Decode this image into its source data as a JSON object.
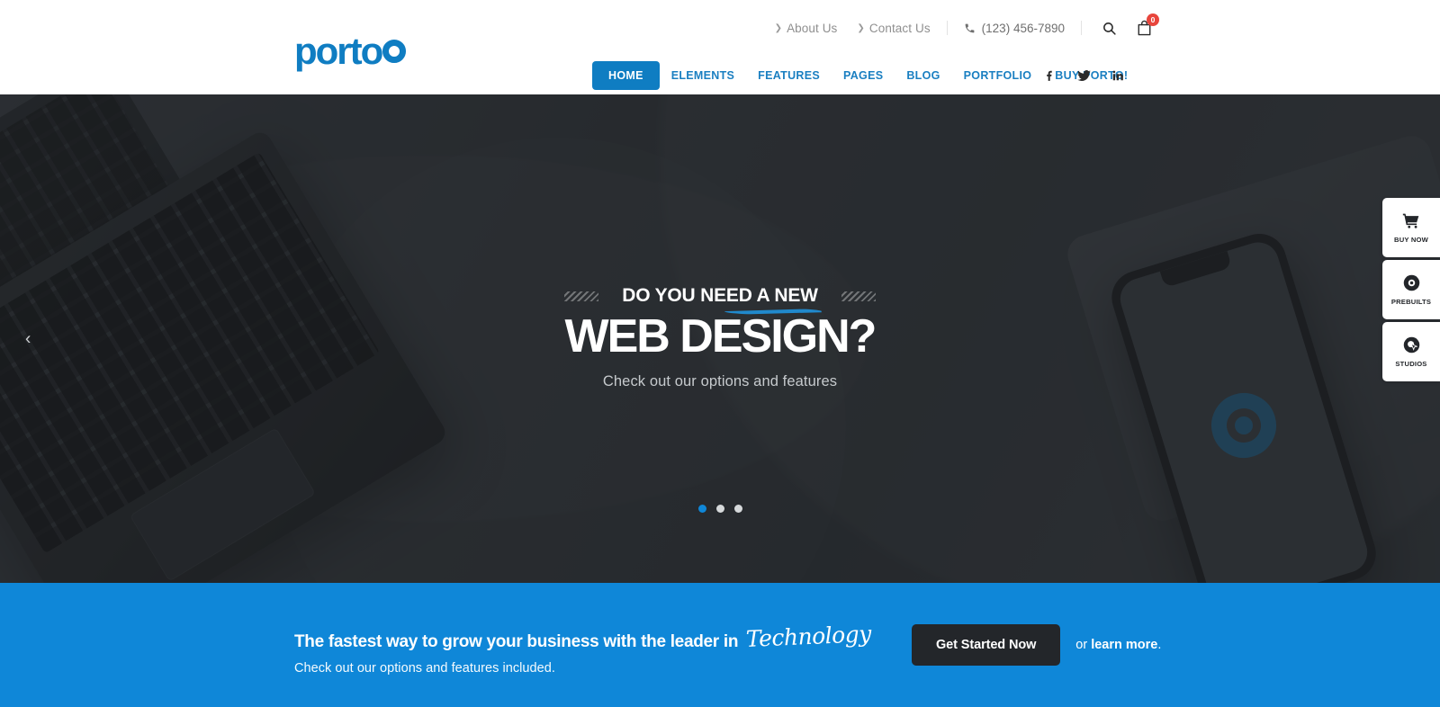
{
  "topbar": {
    "links": [
      {
        "label": "About Us",
        "icon": "chevron-right-icon"
      },
      {
        "label": "Contact Us",
        "icon": "chevron-right-icon"
      }
    ],
    "phone": "(123) 456-7890",
    "phone_icon": "phone-icon",
    "search_icon": "search-icon",
    "cart_icon": "shopping-bag-icon",
    "cart_count": "0"
  },
  "brand": {
    "name": "porto",
    "color": "#0f7dc2"
  },
  "nav": {
    "items": [
      {
        "label": "HOME",
        "active": true
      },
      {
        "label": "ELEMENTS",
        "active": false
      },
      {
        "label": "FEATURES",
        "active": false
      },
      {
        "label": "PAGES",
        "active": false
      },
      {
        "label": "BLOG",
        "active": false
      },
      {
        "label": "PORTFOLIO",
        "active": false
      },
      {
        "label": "BUY PORTO!",
        "active": false
      }
    ],
    "social": [
      {
        "name": "facebook-icon",
        "glyph": "f"
      },
      {
        "name": "twitter-icon",
        "glyph": "t"
      },
      {
        "name": "linkedin-icon",
        "glyph": "in"
      }
    ]
  },
  "hero": {
    "eyebrow": "DO YOU NEED A NEW",
    "headline": "WEB DESIGN?",
    "subhead": "Check out our options and features",
    "prev_arrow": "‹",
    "slides": [
      {
        "active": true
      },
      {
        "active": false
      },
      {
        "active": false
      }
    ],
    "background_color": "#32363b",
    "accent_color": "#2089cc"
  },
  "side_tabs": [
    {
      "label": "BUY NOW",
      "icon": "shopping-cart-icon"
    },
    {
      "label": "PREBUILTS",
      "icon": "disc-icon"
    },
    {
      "label": "STUDIOS",
      "icon": "cursor-click-icon"
    }
  ],
  "cta": {
    "title_main": "The fastest way to grow your business with the leader in",
    "title_script": "Technology",
    "subtitle": "Check out our options and features included.",
    "button_label": "Get Started Now",
    "or_text": "or ",
    "link_label": "learn more",
    "period": ".",
    "background_color": "#0f87d8"
  }
}
